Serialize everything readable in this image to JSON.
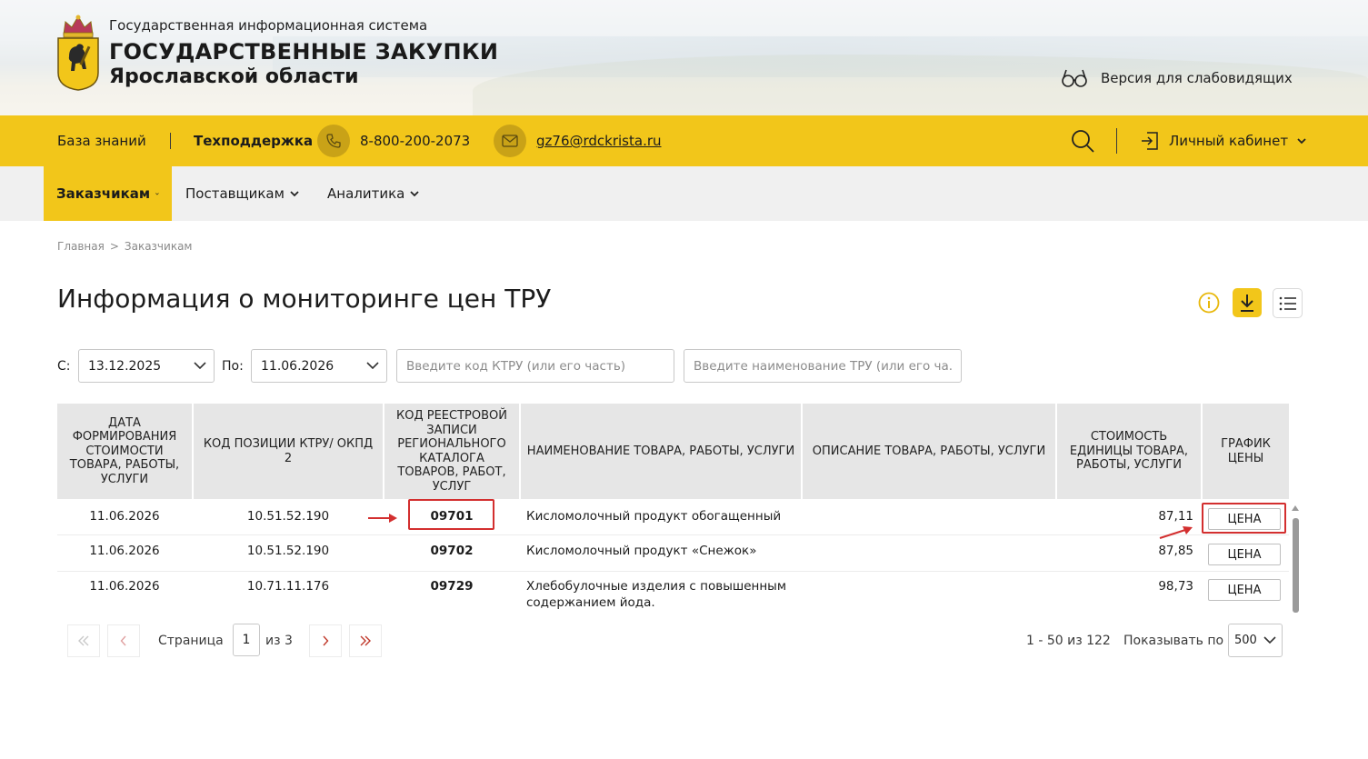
{
  "header": {
    "system_name": "Государственная информационная система",
    "title_line1": "ГОСУДАРСТВЕННЫЕ ЗАКУПКИ",
    "title_line2": "Ярославской области",
    "accessibility_label": "Версия для слабовидящих",
    "logo_icon": "yaroslavl-coat-of-arms-icon"
  },
  "topbar": {
    "knowledge_base": "База знаний",
    "support_label": "Техподдержка",
    "phone": "8-800-200-2073",
    "email": "gz76@rdckrista.ru",
    "account_label": "Личный кабинет",
    "accent_color": "#f2c61a"
  },
  "nav": {
    "tabs": [
      {
        "label": "Заказчикам",
        "active": true
      },
      {
        "label": "Поставщикам",
        "active": false
      },
      {
        "label": "Аналитика",
        "active": false
      }
    ]
  },
  "breadcrumb": {
    "home": "Главная",
    "separator": ">",
    "current": "Заказчикам"
  },
  "page": {
    "title": "Информация о мониторинге цен ТРУ"
  },
  "filters": {
    "from_label": "С:",
    "from_value": "13.12.2025",
    "to_label": "По:",
    "to_value": "11.06.2026",
    "ktru_placeholder": "Введите код КТРУ (или его часть)",
    "name_placeholder": "Введите наименование ТРУ (или его ча..."
  },
  "table": {
    "columns": [
      "ДАТА ФОРМИРОВАНИЯ СТОИМОСТИ ТОВАРА, РАБОТЫ, УСЛУГИ",
      "КОД ПОЗИЦИИ КТРУ/ ОКПД 2",
      "КОД РЕЕСТРОВОЙ ЗАПИСИ РЕГИОНАЛЬНОГО КАТАЛОГА ТОВАРОВ, РАБОТ, УСЛУГ",
      "НАИМЕНОВАНИЕ ТОВАРА, РАБОТЫ, УСЛУГИ",
      "ОПИСАНИЕ ТОВАРА, РАБОТЫ, УСЛУГИ",
      "СТОИМОСТЬ ЕДИНИЦЫ ТОВАРА, РАБОТЫ, УСЛУГИ",
      "ГРАФИК ЦЕНЫ"
    ],
    "price_button_label": "ЦЕНА",
    "rows": [
      {
        "date": "11.06.2026",
        "code": "10.51.52.190",
        "registry": "09701",
        "name": "Кисломолочный продукт обогащенный",
        "description": "",
        "price": "87,11"
      },
      {
        "date": "11.06.2026",
        "code": "10.51.52.190",
        "registry": "09702",
        "name": "Кисломолочный продукт «Снежок»",
        "description": "",
        "price": "87,85"
      },
      {
        "date": "11.06.2026",
        "code": "10.71.11.176",
        "registry": "09729",
        "name": "Хлебобулочные изделия с повышенным содержанием йода.",
        "description": "",
        "price": "98,73"
      }
    ],
    "highlight_color": "#d32f2f"
  },
  "pagination": {
    "page_label": "Страница",
    "current_page": "1",
    "of_label": "из 3",
    "range_label": "1 - 50 из 122",
    "per_page_label": "Показывать по",
    "per_page_value": "500"
  }
}
